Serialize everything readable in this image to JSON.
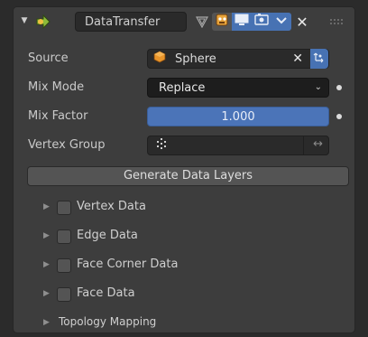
{
  "header": {
    "modifier_name": "DataTransfer",
    "icons": [
      "collapse-triangle-icon",
      "data-transfer-modifier-icon",
      "on-cage-icon",
      "edit-mode-icon",
      "viewport-display-icon",
      "render-icon",
      "dropdown-chevron-icon",
      "close-icon",
      "drag-grip-icon"
    ]
  },
  "properties": {
    "source": {
      "label": "Source",
      "value": "Sphere",
      "icon": "mesh-sphere-icon"
    },
    "mix_mode": {
      "label": "Mix Mode",
      "value": "Replace"
    },
    "mix_factor": {
      "label": "Mix Factor",
      "value": "1.000"
    },
    "vertex_group": {
      "label": "Vertex Group",
      "value": ""
    }
  },
  "generate_button": {
    "label": "Generate Data Layers"
  },
  "subpanels": [
    {
      "label": "Vertex Data",
      "checked": false
    },
    {
      "label": "Edge Data",
      "checked": false
    },
    {
      "label": "Face Corner Data",
      "checked": false
    },
    {
      "label": "Face Data",
      "checked": false
    },
    {
      "label": "Topology Mapping"
    }
  ],
  "colors": {
    "panel_bg": "#3d3d3d",
    "accent_blue": "#4772b3",
    "field_dark": "#2a2a2a"
  }
}
